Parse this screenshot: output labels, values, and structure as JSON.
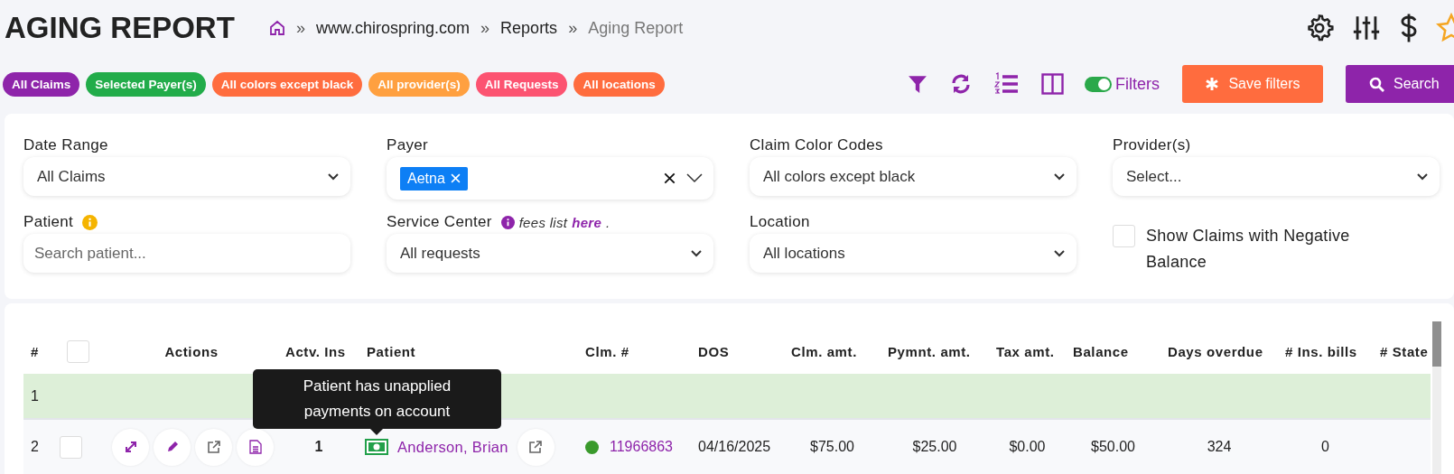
{
  "title": "AGING REPORT",
  "breadcrumb": {
    "separator": "»",
    "items": [
      {
        "label": "www.chirospring.com",
        "current": false
      },
      {
        "label": "Reports",
        "current": false
      },
      {
        "label": "Aging Report",
        "current": true
      }
    ]
  },
  "chips": [
    {
      "label": "All Claims",
      "color": "#8e24aa"
    },
    {
      "label": "Selected Payer(s)",
      "color": "#22ac4a"
    },
    {
      "label": "All colors except black",
      "color": "#ff6c3e"
    },
    {
      "label": "All provider(s)",
      "color": "#ffa040"
    },
    {
      "label": "All Requests",
      "color": "#fc5371"
    },
    {
      "label": "All locations",
      "color": "#ff6c3e"
    }
  ],
  "toolbar": {
    "filters_toggle": {
      "label": "Filters",
      "on": true
    },
    "save_button": "Save filters",
    "search_button": "Search"
  },
  "filters": [
    {
      "kind": "select",
      "label": "Date Range",
      "value": "All Claims"
    },
    {
      "kind": "multiselect",
      "label": "Payer",
      "tags": [
        "Aetna"
      ]
    },
    {
      "kind": "select",
      "label": "Claim Color Codes",
      "value": "All colors except black"
    },
    {
      "kind": "select",
      "label": "Provider(s)",
      "value": "Select..."
    },
    {
      "kind": "input",
      "label": "Patient",
      "info": true,
      "placeholder": "Search patient..."
    },
    {
      "kind": "select",
      "label": "Service Center",
      "value": "All requests",
      "note": {
        "text": "fees list ",
        "link": "here",
        "after": "."
      }
    },
    {
      "kind": "select",
      "label": "Location",
      "value": "All locations"
    },
    {
      "kind": "checkbox",
      "label": "Show Claims with Negative Balance",
      "checked": false
    }
  ],
  "table": {
    "columns": [
      "#",
      "",
      "Actions",
      "Actv. Ins",
      "Patient",
      "Clm. #",
      "DOS",
      "Clm. amt.",
      "Pymnt. amt.",
      "Tax amt.",
      "Balance",
      "Days overdue",
      "# Ins. bills",
      "# State"
    ],
    "header_checked": false,
    "rows": [
      {
        "kind": "group",
        "index": "1"
      },
      {
        "kind": "claim",
        "index": "2",
        "checked": false,
        "actv_ins": "1",
        "patient": "Anderson, Brian",
        "color": "#3a9a2c",
        "claim_no": "11966863",
        "dos": "04/16/2025",
        "clm_amt": "$75.00",
        "pymnt_amt": "$25.00",
        "tax_amt": "$0.00",
        "balance": "$50.00",
        "days_overdue": "324",
        "ins_bills": "0"
      }
    ]
  },
  "tooltip": "Patient has unapplied payments on account"
}
